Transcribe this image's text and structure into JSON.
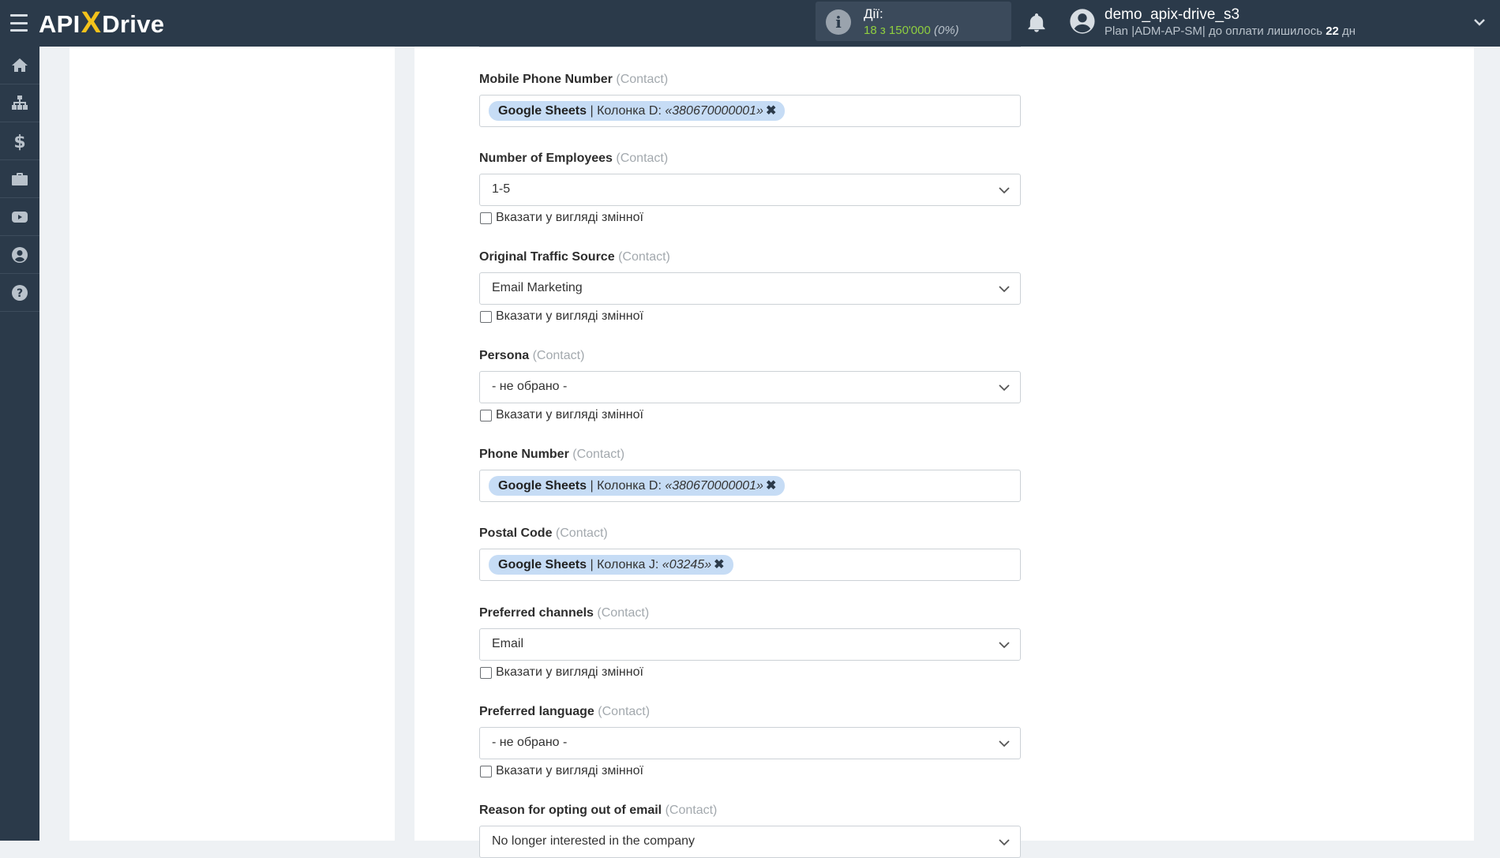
{
  "header": {
    "logo": {
      "a": "API",
      "x": "X",
      "b": "Drive"
    },
    "actions": {
      "label": "Дії:",
      "value": "18 з 150'000",
      "percent": "(0%)"
    },
    "user": {
      "name": "demo_apix-drive_s3",
      "plan_prefix": "Plan |ADM-AP-SM| до оплати лишилось",
      "days": "22",
      "days_suffix": "дн"
    }
  },
  "sidebar": {
    "items": [
      "home-icon",
      "sitemap-icon",
      "dollar-icon",
      "briefcase-icon",
      "youtube-icon",
      "user-circle-icon",
      "help-icon"
    ]
  },
  "form": {
    "context": "(Contact)",
    "checkbox_label": "Вказати у вигляді змінної",
    "fields": [
      {
        "label": "Mobile Phone Number",
        "tag": {
          "source": "Google Sheets",
          "column": "| Колонка D:",
          "value": "«380670000001»"
        }
      },
      {
        "label": "Number of Employees",
        "value": "1-5"
      },
      {
        "label": "Original Traffic Source",
        "value": "Email Marketing"
      },
      {
        "label": "Persona",
        "value": "- не обрано -"
      },
      {
        "label": "Phone Number",
        "tag": {
          "source": "Google Sheets",
          "column": "| Колонка D:",
          "value": "«380670000001»"
        }
      },
      {
        "label": "Postal Code",
        "tag": {
          "source": "Google Sheets",
          "column": "| Колонка J:",
          "value": "«03245»"
        }
      },
      {
        "label": "Preferred channels",
        "value": "Email"
      },
      {
        "label": "Preferred language",
        "value": "- не обрано -"
      },
      {
        "label": "Reason for opting out of email",
        "value": "No longer interested in the company"
      }
    ]
  },
  "colors": {
    "topbar": "#2b3a4a",
    "accent": "#f3c21b",
    "tag_bg": "#c6dcf5",
    "actions_value": "#8fcf3f"
  }
}
